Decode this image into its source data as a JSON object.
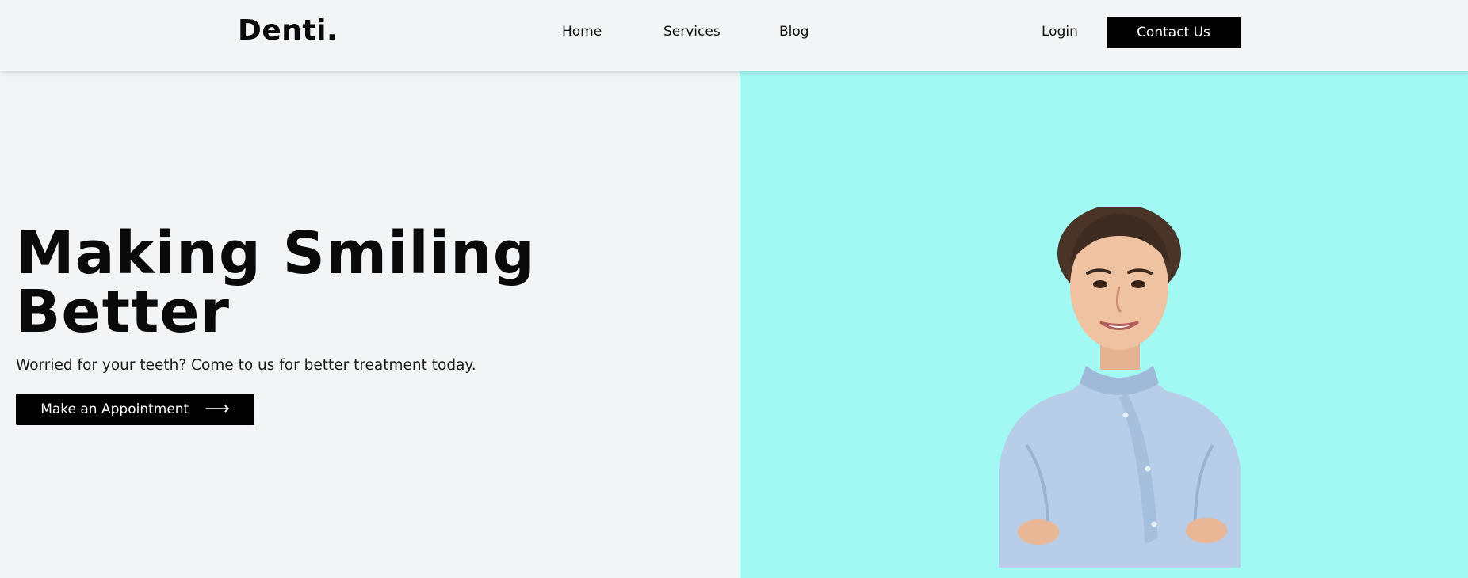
{
  "header": {
    "logo": "Denti.",
    "nav": {
      "home": "Home",
      "services": "Services",
      "blog": "Blog"
    },
    "login": "Login",
    "contact": "Contact Us"
  },
  "hero": {
    "title_line1": "Making Smiling",
    "title_line2": "Better",
    "subtitle": "Worried for your teeth? Come to us for better treatment today.",
    "cta_label": "Make an Appointment",
    "cta_icon": "arrow-right-icon",
    "panel_color": "#a2f8f3"
  }
}
